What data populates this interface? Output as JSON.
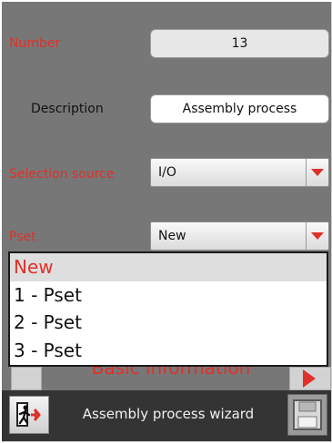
{
  "form": {
    "number": {
      "label": "Number",
      "value": "13"
    },
    "description": {
      "label": "Description",
      "value": "Assembly process"
    },
    "selection_source": {
      "label": "Selection source",
      "value": "I/O"
    },
    "pset": {
      "label": "Pset",
      "value": "New"
    }
  },
  "dropdown": {
    "options": [
      "New",
      "1 - Pset",
      "2 - Pset",
      "3 - Pset"
    ],
    "selected_index": 0
  },
  "section": {
    "title": "Basic information"
  },
  "footer": {
    "title": "Assembly process wizard",
    "exit_icon": "exit-door-icon",
    "save_icon": "floppy-disk-icon"
  },
  "colors": {
    "accent": "#e0302a",
    "background": "#777777",
    "footer": "#343434"
  }
}
